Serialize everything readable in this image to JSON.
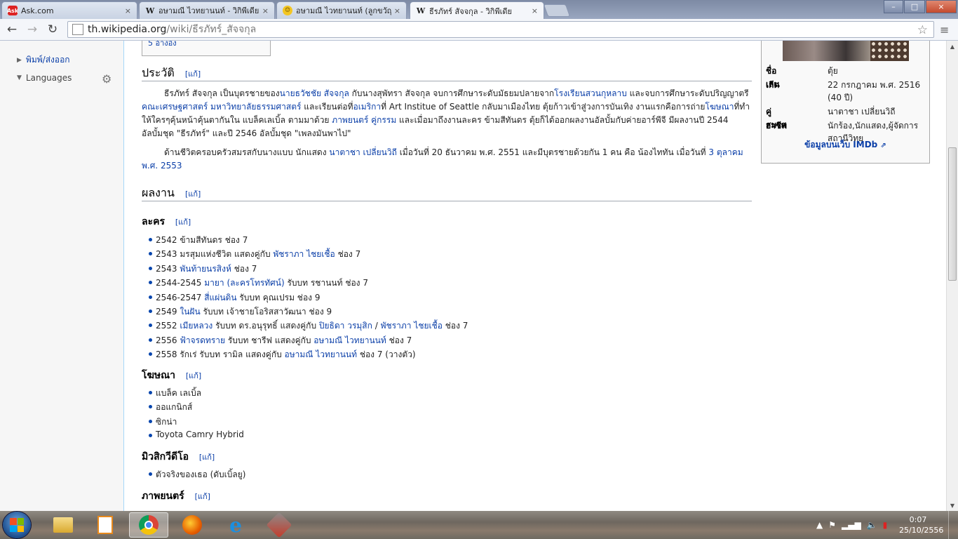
{
  "browser": {
    "tabs": [
      {
        "favicon": "ask-icon",
        "title": "Ask.com",
        "active": false
      },
      {
        "favicon": "wikipedia-icon",
        "title": "อษามณี ไวทยานนท์ - วิกิพีเดีย",
        "active": false
      },
      {
        "favicon": "smiley-icon",
        "title": "อษามณี ไวทยานนท์ (ลูกขวัญ)",
        "active": false
      },
      {
        "favicon": "wikipedia-icon",
        "title": "ธีรภัทร์ สัจจกุล - วิกิพีเดีย",
        "active": true
      }
    ],
    "close_glyph": "×",
    "window_controls": {
      "minimize": "–",
      "maximize": "□",
      "close": "×"
    },
    "url_host": "th.wikipedia.org",
    "url_path": "/wiki/ธีรภัทร์_สัจจกุล"
  },
  "sidebar": {
    "print_export": "พิมพ์/ส่งออก",
    "languages": "Languages"
  },
  "toc_stub": "5 อ้างอิง",
  "sections": {
    "biography_title": "ประวัติ",
    "edit_label": "[แก้]",
    "bio_para1_parts": [
      "ธีรภัทร์ สัจจกุล เป็นบุตรชายของ",
      "นายธวัชชัย สัจจกุล",
      " กับนางสุพัทรา สัจจกุล จบการศึกษาระดับมัธยมปลายจาก",
      "โรงเรียนสวนกุหลาบ",
      " และจบการศึกษาระดับปริญญาตรี ",
      "คณะเศรษฐศาสตร์ มหาวิทยาลัยธรรมศาสตร์",
      " และเรียนต่อที่",
      "อเมริกา",
      "ที่ Art Institue of Seattle กลับมาเมืองไทย ตุ้ยก้าวเข้าสู่วงการบันเทิง งานแรกคือการถ่าย",
      "โฆษณา",
      "ที่ทำให้ใครๆคุ้นหน้าคุ้นตากันใน แบล็คเลเบิ้ล ตามมาด้วย ",
      "ภาพยนตร์",
      " ",
      "คู่กรรม",
      " และเมื่อมาถึงงานละคร ข้ามสีทันดร ตุ้ยก็ได้ออกผลงานอัลบั้มกับค่ายอาร์พีจี มีผลงานปี 2544 อัลบั้มชุด \"ธีรภัทร์\" และปี 2546 อัลบั้มชุด \"เพลงมันพาไป\""
    ],
    "bio_para2_parts": [
      "ด้านชีวิตครอบครัวสมรสกับนางแบบ นักแสดง ",
      "นาตาชา เปลี่ยนวิถี",
      " เมื่อวันที่ 20 ธันวาคม พ.ศ. 2551 และมีบุตรชายด้วยกัน 1 คน คือ น้องไททัน เมื่อวันที่ ",
      "3 ตุลาคม",
      " ",
      "พ.ศ. 2553"
    ],
    "works_title": "ผลงาน",
    "drama_title": "ละคร",
    "drama_items": [
      [
        "2542 ข้ามสีทันดร ช่อง 7"
      ],
      [
        "2543 มรสุมแห่งชีวิต แสดงคู่กับ ",
        "พัชราภา ไชยเชื้อ",
        " ช่อง 7"
      ],
      [
        "2543 ",
        "พันท้ายนรสิงห์",
        " ช่อง 7"
      ],
      [
        "2544-2545 ",
        "มายา (ละครโทรทัศน์)",
        " รับบท รชานนท์ ช่อง 7"
      ],
      [
        "2546-2547 ",
        "สี่แผ่นดิน",
        " รับบท คุณเปรม ช่อง 9"
      ],
      [
        "2549 ",
        "ในฝัน",
        " รับบท เจ้าชายโอริสสาวัฒนา ช่อง 9"
      ],
      [
        "2552 ",
        "เมียหลวง",
        " รับบท ดร.อนุรุทธิ์ แสดงคู่กับ ",
        "ปิยธิดา วรมุสิก",
        " / ",
        "พัชราภา ไชยเชื้อ",
        " ช่อง 7"
      ],
      [
        "2556 ",
        "ฟ้าจรดทราย",
        " รับบท ชารีฟ แสดงคู่กับ ",
        "อษามณี ไวทยานนท์",
        " ช่อง 7"
      ],
      [
        "2558 รักเร่ รับบท รามิล แสดงคู่กับ ",
        "อษามณี ไวทยานนท์",
        " ช่อง 7 (วางตัว)"
      ]
    ],
    "ads_title": "โฆษณา",
    "ads_items": [
      "แบล็ค เลเบิ้ล",
      "ออแกนิกส์",
      "ซิกน่า",
      "Toyota Camry Hybrid"
    ],
    "mv_title": "มิวสิกวีดีโอ",
    "mv_items": [
      "ตัวจริงของเธอ (ดับเบิ้ลยู)"
    ],
    "film_title": "ภาพยนตร์"
  },
  "infobox": {
    "rows": [
      {
        "key": "ชื่อเล่น",
        "val": "ตุ้ย",
        "link": false
      },
      {
        "key": "เกิด",
        "val": "22 กรกฎาคม พ.ศ. 2516 (40 ปี)",
        "link": false
      },
      {
        "key": "คู่สมรส",
        "val": "นาตาชา เปลี่ยนวิถี",
        "link": true
      },
      {
        "key": "อาชีพ",
        "val": "นักร้อง,นักแสดง,ผู้จัดการสถานีวิทยุ",
        "link": false
      }
    ],
    "imdb": "ข้อมูลบนเว็บ IMDb"
  },
  "taskbar": {
    "clock_time": "0:07",
    "clock_date": "25/10/2556"
  }
}
